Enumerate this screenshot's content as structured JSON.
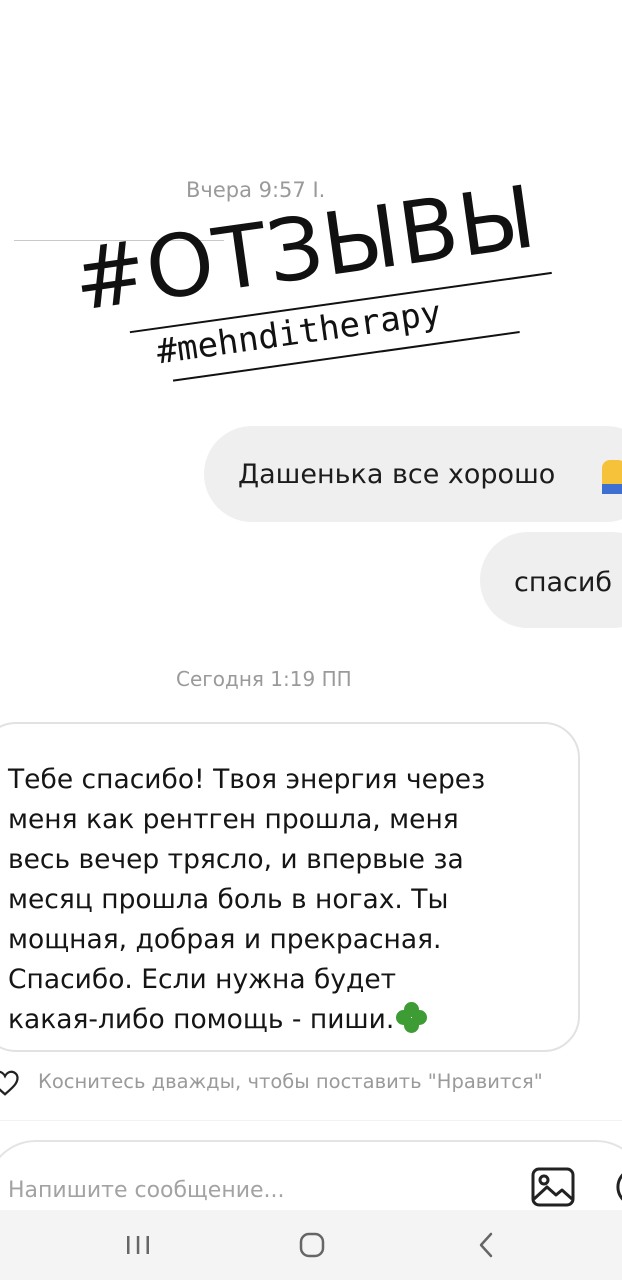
{
  "chat": {
    "timestamp_yesterday": "Вчера 9:57 I.",
    "timestamp_today": "Сегодня 1:19 ПП",
    "messages": [
      {
        "direction": "outgoing",
        "text": "Дашенька все хорошо"
      },
      {
        "direction": "outgoing",
        "text": "спасиб"
      },
      {
        "direction": "incoming",
        "text": "Тебе спасибо! Твоя энергия через\nменя как рентген прошла, меня\nвесь вечер трясло, и впервые за\nмесяц прошла боль в ногах. Ты\nмощная, добрая и прекрасная.\nСпасибо. Если нужна будет\nкакая-либо помощь - пиши."
      }
    ],
    "like_hint": "Коснитесь дважды, чтобы поставить \"Нравится\""
  },
  "sticker": {
    "title": "#ОТЗЫВЫ",
    "subtitle": "#mehnditherapy"
  },
  "composer": {
    "placeholder": "Напишите сообщение...",
    "value": ""
  },
  "icons": {
    "message_emoji_1": "folded-hands-emoji",
    "message_emoji_2": "four-leaf-clover-emoji",
    "like": "heart-outline-icon",
    "composer_image": "image-gallery-icon",
    "nav_recents": "recent-apps-icon",
    "nav_home": "home-icon",
    "nav_back": "back-chevron-icon"
  },
  "colors": {
    "outgoing_bubble": "#efefef",
    "incoming_border": "#e2e2e2",
    "muted_text": "#9a9a9a",
    "clover_green": "#3e9c35",
    "navbar_bg": "#f4f4f4"
  }
}
